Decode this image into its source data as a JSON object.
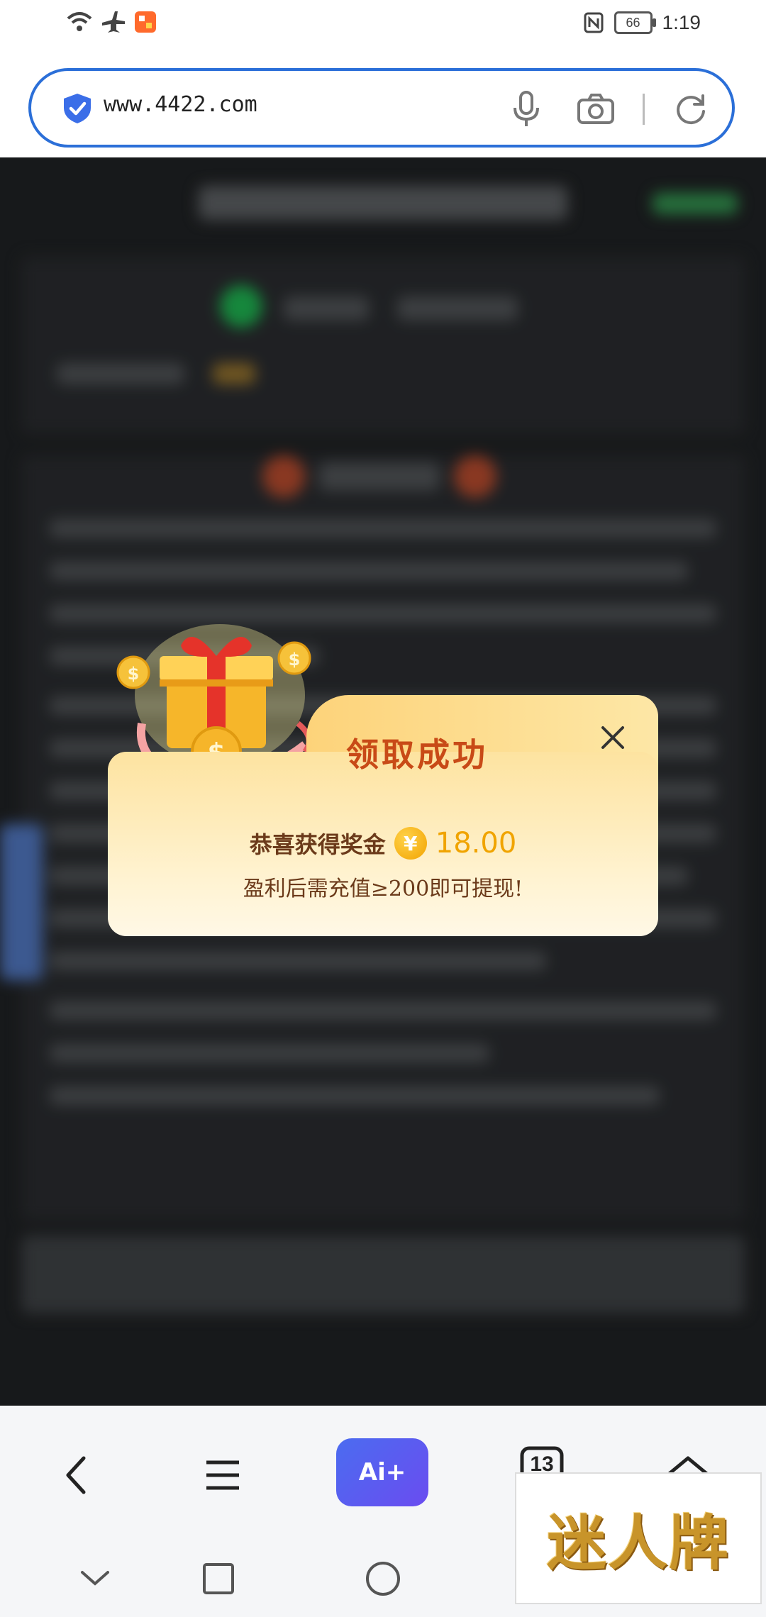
{
  "status_bar": {
    "time": "1:19",
    "battery": "66"
  },
  "browser": {
    "url": "www.4422.com"
  },
  "modal": {
    "title": "领取成功",
    "reward_label": "恭喜获得奖金",
    "currency_symbol": "¥",
    "amount": "18.00",
    "note": "盈利后需充值≥200即可提现!"
  },
  "toolbar": {
    "ai_label": "Ai+",
    "tab_count": "13"
  },
  "watermark": {
    "text": "迷人牌"
  },
  "colors": {
    "accent": "#2b6fd8",
    "modal_title": "#c84a17",
    "amount": "#f0a400",
    "ai_button": "#5a5cf0"
  }
}
